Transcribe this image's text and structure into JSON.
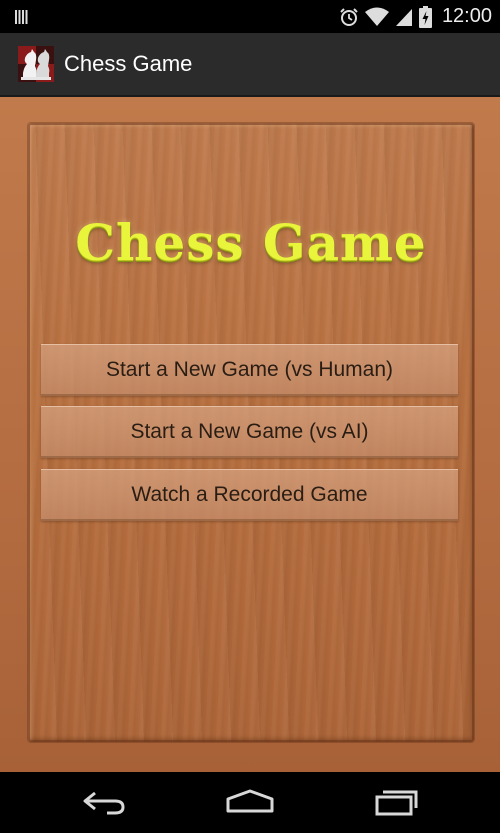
{
  "status_bar": {
    "time": "12:00",
    "icons": [
      "barcode-icon",
      "alarm-icon",
      "wifi-icon",
      "signal-icon",
      "battery-charging-icon"
    ]
  },
  "action_bar": {
    "app_icon": "chess-knights-icon",
    "title": "Chess Game"
  },
  "main": {
    "game_title": "Chess Game",
    "buttons": [
      {
        "label": "Start a New Game (vs Human)"
      },
      {
        "label": "Start a New Game (vs AI)"
      },
      {
        "label": "Watch a Recorded Game"
      }
    ]
  },
  "nav_bar": {
    "icons": [
      "back-icon",
      "home-icon",
      "recent-apps-icon"
    ]
  },
  "colors": {
    "wood": "#b8703f",
    "title_text": "#e9f53a",
    "action_bar": "#2b2b2b"
  }
}
